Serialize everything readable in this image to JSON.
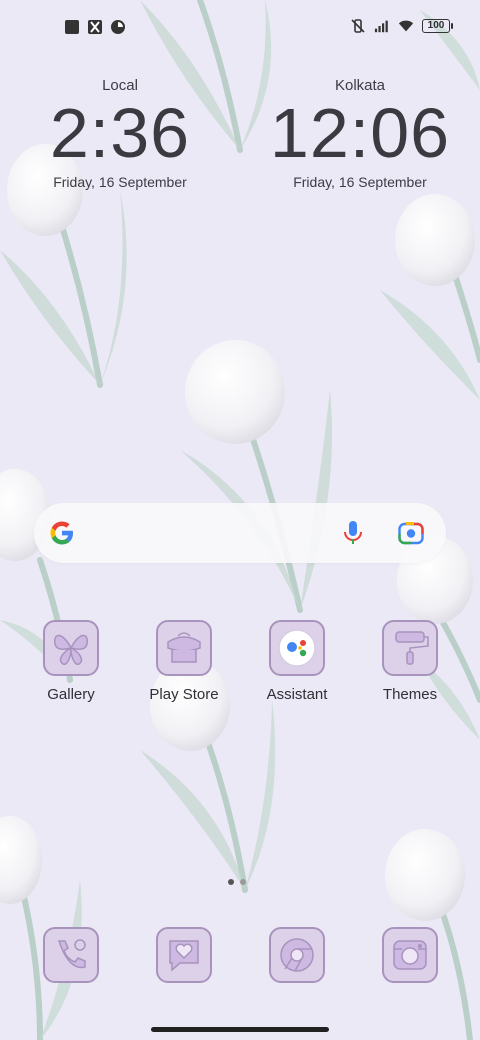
{
  "status_bar": {
    "left_icons": [
      "square-notification-icon",
      "hourglass-notification-icon",
      "pie-notification-icon"
    ],
    "right_icons": [
      "vibrate-off-icon",
      "signal-icon",
      "wifi-icon"
    ],
    "battery": "100"
  },
  "clocks": [
    {
      "city": "Local",
      "time": "2:36",
      "date": "Friday, 16 September"
    },
    {
      "city": "Kolkata",
      "time": "12:06",
      "date": "Friday, 16 September"
    }
  ],
  "search_bar": {
    "icons": [
      "google-g-icon",
      "mic-icon",
      "lens-icon"
    ]
  },
  "apps": [
    {
      "label": "Gallery",
      "icon": "butterfly-icon"
    },
    {
      "label": "Play Store",
      "icon": "store-icon"
    },
    {
      "label": "Assistant",
      "icon": "assistant-icon"
    },
    {
      "label": "Themes",
      "icon": "paint-roller-icon"
    }
  ],
  "dock": [
    {
      "icon": "phone-icon"
    },
    {
      "icon": "message-heart-icon"
    },
    {
      "icon": "chrome-icon"
    },
    {
      "icon": "camera-icon"
    }
  ],
  "page_indicator": {
    "pages": 2,
    "current": 1
  },
  "colors": {
    "background": "#ece9f6",
    "icon_fill": "#ddd1ea",
    "icon_stroke": "#a893bd",
    "google_blue": "#4285F4",
    "google_red": "#EA4335",
    "google_yellow": "#FBBC05",
    "google_green": "#34A853"
  }
}
